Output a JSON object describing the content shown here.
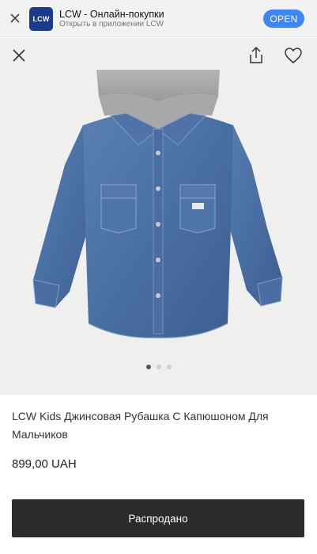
{
  "banner": {
    "app_icon_text": "LCW",
    "app_name": "LCW - Онлайн-покупки",
    "app_subtitle": "Открыть в приложении LCW",
    "open_label": "OPEN"
  },
  "gallery": {
    "current_slide": 1,
    "total_slides": 3
  },
  "product": {
    "title": "LCW Kids Джинсовая Рубашка С Капюшоном Для Мальчиков",
    "price": "899,00 UAH",
    "status_button": "Распродано"
  },
  "icons": {
    "banner_close": "close-icon",
    "product_close": "close-icon",
    "share": "share-icon",
    "favorite": "heart-icon"
  }
}
